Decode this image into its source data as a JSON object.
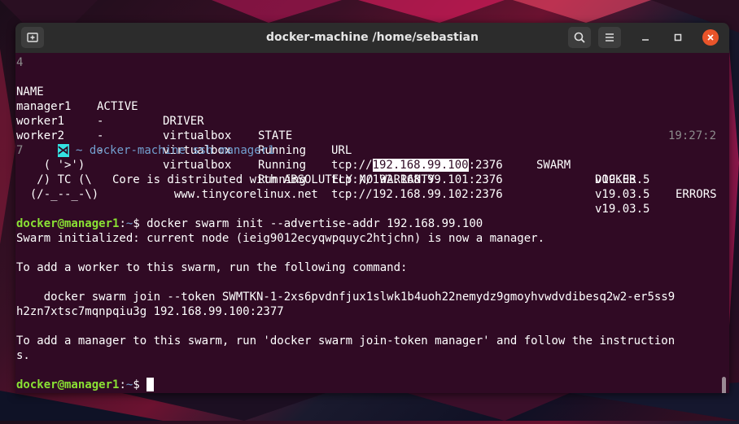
{
  "window": {
    "title": "docker-machine /home/sebastian"
  },
  "terminal": {
    "scroll_fragment_1": "4",
    "scroll_fragment_2": "7",
    "table": {
      "headers": [
        "NAME",
        "ACTIVE",
        "DRIVER",
        "STATE",
        "URL",
        "SWARM",
        "DOCKER",
        "ERRORS"
      ],
      "rows": [
        {
          "name": "manager1",
          "active": "-",
          "driver": "virtualbox",
          "state": "Running",
          "url_prefix": "tcp://",
          "url_host": "192.168.99.100",
          "url_port": ":2376",
          "swarm": "",
          "docker": "v19.03.5",
          "errors": ""
        },
        {
          "name": "worker1",
          "active": "-",
          "driver": "virtualbox",
          "state": "Running",
          "url": "tcp://192.168.99.101:2376",
          "swarm": "",
          "docker": "v19.03.5",
          "errors": ""
        },
        {
          "name": "worker2",
          "active": "-",
          "driver": "virtualbox",
          "state": "Running",
          "url": "tcp://192.168.99.102:2376",
          "swarm": "",
          "docker": "v19.03.5",
          "errors": ""
        }
      ]
    },
    "prompt1": {
      "symbol": "⋊",
      "dir": "~",
      "command_word": "docker-machine",
      "args": "ssh manager1",
      "time": "19:27:2"
    },
    "banner": [
      "    ( '>')",
      "   /) TC (\\   Core is distributed with ABSOLUTELY NO WARRANTY.",
      "  (/-_--_-\\)           www.tinycorelinux.net"
    ],
    "remote_prompt": {
      "userhost": "docker@manager1",
      "sep": ":",
      "path": "~",
      "dollar": "$"
    },
    "cmd1": " docker swarm init --advertise-addr 192.168.99.100",
    "output": [
      "Swarm initialized: current node (ieig9012ecyqwpquyc2htjchn) is now a manager.",
      "",
      "To add a worker to this swarm, run the following command:",
      "",
      "    docker swarm join --token SWMTKN-1-2xs6pvdnfjux1slwk1b4uoh22nemydz9gmoyhvwdvdibesq2w2-er5ss9",
      "h2zn7xtsc7mqnpqiu3g 192.168.99.100:2377",
      "",
      "To add a manager to this swarm, run 'docker swarm join-token manager' and follow the instruction",
      "s."
    ]
  },
  "colors": {
    "terminal_bg": "#300a24",
    "titlebar_bg": "#2c2c2c",
    "prompt_green": "#8ae234",
    "path_blue": "#729fcf",
    "close_orange": "#e9542a"
  },
  "icons": {
    "new_tab": "new-tab-icon",
    "search": "search-icon",
    "menu": "hamburger-menu-icon",
    "minimize": "minimize-icon",
    "maximize": "maximize-icon",
    "close": "close-icon"
  }
}
